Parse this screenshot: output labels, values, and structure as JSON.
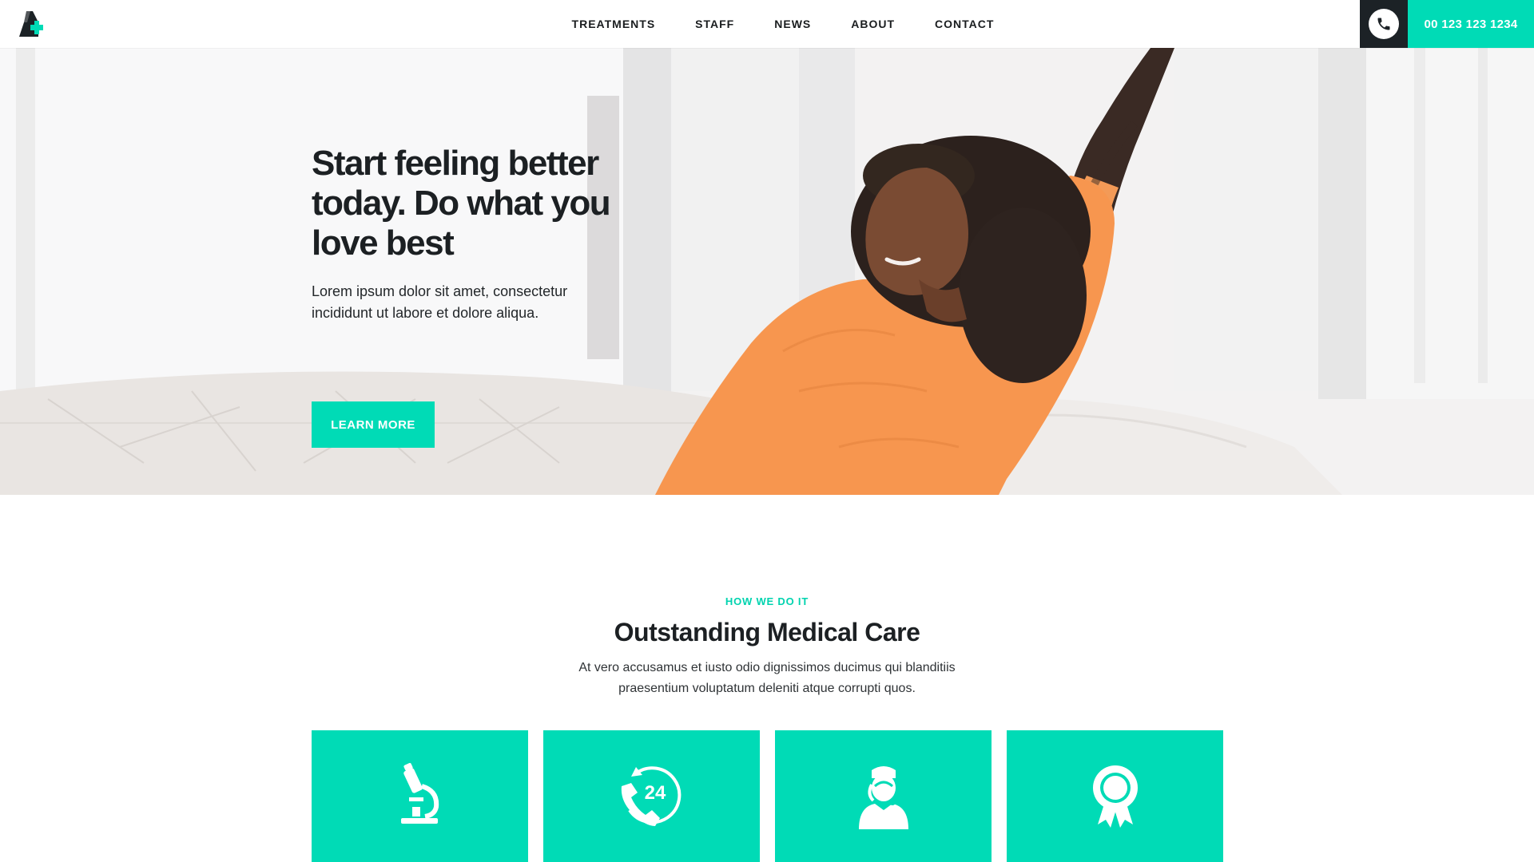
{
  "header": {
    "logo_icon": "medical-cross-logo-icon",
    "nav": [
      {
        "label": "TREATMENTS"
      },
      {
        "label": "STAFF"
      },
      {
        "label": "NEWS"
      },
      {
        "label": "ABOUT"
      },
      {
        "label": "CONTACT"
      }
    ],
    "phone_icon": "phone-icon",
    "phone_number": "00 123 123 1234"
  },
  "hero": {
    "title": "Start feeling better today. Do what you love best",
    "text": "Lorem ipsum dolor sit amet, consectetur incididunt ut labore et dolore aliqua.",
    "button_label": "LEARN MORE",
    "image": "woman-stretching-on-sofa-photo"
  },
  "section": {
    "eyebrow": "HOW WE DO IT",
    "title": "Outstanding Medical Care",
    "text": "At vero accusamus et iusto odio dignissimos ducimus qui blanditiis praesentium voluptatum deleniti atque corrupti quos.",
    "cards": [
      {
        "icon": "microscope-icon"
      },
      {
        "icon": "phone-24-hours-icon",
        "icon_text": "24"
      },
      {
        "icon": "nurse-icon"
      },
      {
        "icon": "award-ribbon-icon"
      }
    ]
  },
  "colors": {
    "accent": "#00dbb6",
    "dark": "#1c2226",
    "text": "#1c2023"
  }
}
